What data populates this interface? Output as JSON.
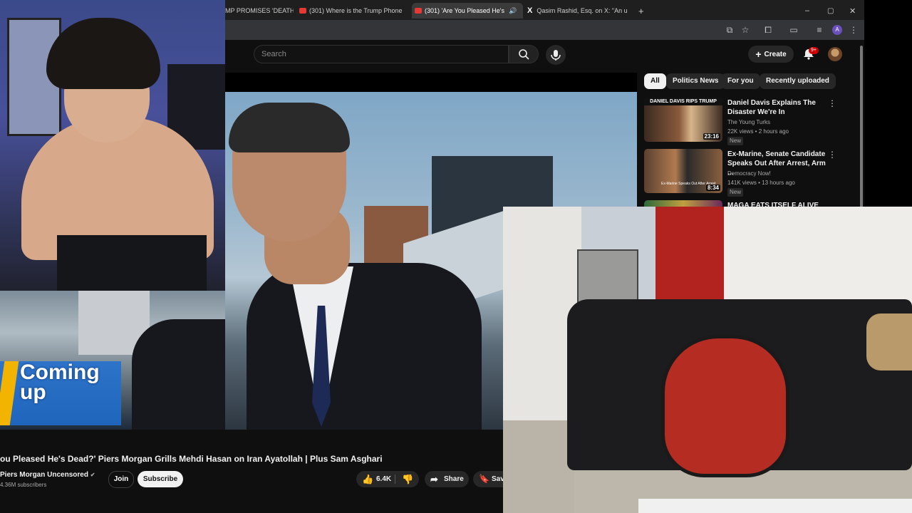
{
  "browser": {
    "tabs": [
      {
        "label": "MP PROMISES 'DEATH",
        "icon": "x-icon"
      },
      {
        "label": "(301) Where is the Trump Phone",
        "icon": "youtube-icon"
      },
      {
        "label": "(301) 'Are You Pleased He's",
        "icon": "youtube-icon",
        "active": true
      },
      {
        "label": "Qasim Rashid, Esq. on X: \"An u",
        "icon": "x-icon"
      }
    ],
    "new_tab": "+",
    "window_controls": [
      "–",
      "▢",
      "✕"
    ]
  },
  "youtube": {
    "search_placeholder": "Search",
    "create_label": "Create",
    "notifications_badge": "9+",
    "chips": [
      "All",
      "Politics News",
      "For you",
      "Recently uploaded"
    ],
    "recommendations": [
      {
        "title": "Daniel Davis Explains The Disaster We're In",
        "channel": "The Young Turks",
        "meta": "22K views • 2 hours ago",
        "badge": "New",
        "duration": "23:16",
        "thumb_caption": "DANIEL DAVIS RIPS TRUMP"
      },
      {
        "title": "Ex-Marine, Senate Candidate Speaks Out After Arrest, Arm ...",
        "channel": "Democracy Now!",
        "meta": "141K views • 13 hours ago",
        "badge": "New",
        "duration": "8:34",
        "thumb_caption": "Ex-Marine Speaks Out After Arrest"
      },
      {
        "title": "MAGA EATS ITSELF ALIVE As",
        "channel": "",
        "meta": "",
        "badge": "",
        "duration": "",
        "thumb_caption": ""
      }
    ],
    "video": {
      "title": "ou Pleased He's Dead?' Piers Morgan Grills Mehdi Hasan on Iran Ayatollah | Plus Sam Asghari",
      "channel": "Piers Morgan Uncensored",
      "subscribers": "4.36M subscribers",
      "join_label": "Join",
      "subscribe_label": "Subscribe",
      "likes": "6.4K",
      "share_label": "Share",
      "save_label": "Sav"
    },
    "overlay": {
      "coming_up_line1": "Coming",
      "coming_up_line2": "up"
    }
  },
  "colors": {
    "youtube_red": "#ff0000",
    "chip_selected": "#f1f1f1",
    "dark_bg": "#0f0f0f"
  }
}
